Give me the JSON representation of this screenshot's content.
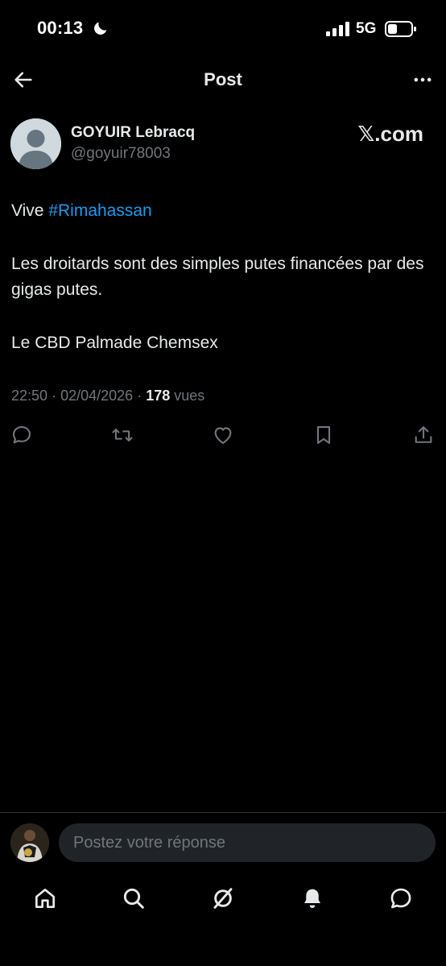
{
  "status_bar": {
    "time": "00:13",
    "network": "5G",
    "icons": [
      "moon-icon",
      "signal-icon",
      "battery-icon"
    ]
  },
  "nav": {
    "title": "Post",
    "icons": [
      "back-arrow-icon",
      "more-dots-icon"
    ]
  },
  "post": {
    "author_name": "GOYUIR Lebracq",
    "author_handle": "@goyuir78003",
    "brand": "𝕏.com",
    "body_prefix": "Vive ",
    "hashtag": "#Rimahassan",
    "line2": "Les droitards sont des simples putes financées par des gigas putes.",
    "line3": "Le CBD Palmade Chemsex",
    "time": "22:50",
    "date": "02/04/2026",
    "views_count": "178",
    "views_label": "vues",
    "separator": "·"
  },
  "actions": [
    "reply-icon",
    "repost-icon",
    "like-icon",
    "bookmark-icon",
    "share-icon"
  ],
  "reply_bar": {
    "placeholder": "Postez votre réponse"
  },
  "tabs": [
    "home-icon",
    "search-icon",
    "grok-icon",
    "notifications-icon",
    "messages-icon"
  ],
  "colors": {
    "background": "#000000",
    "text": "#e7e9ea",
    "secondary_text": "#71767b",
    "accent": "#1d9bf0",
    "input_bg": "#202327"
  }
}
